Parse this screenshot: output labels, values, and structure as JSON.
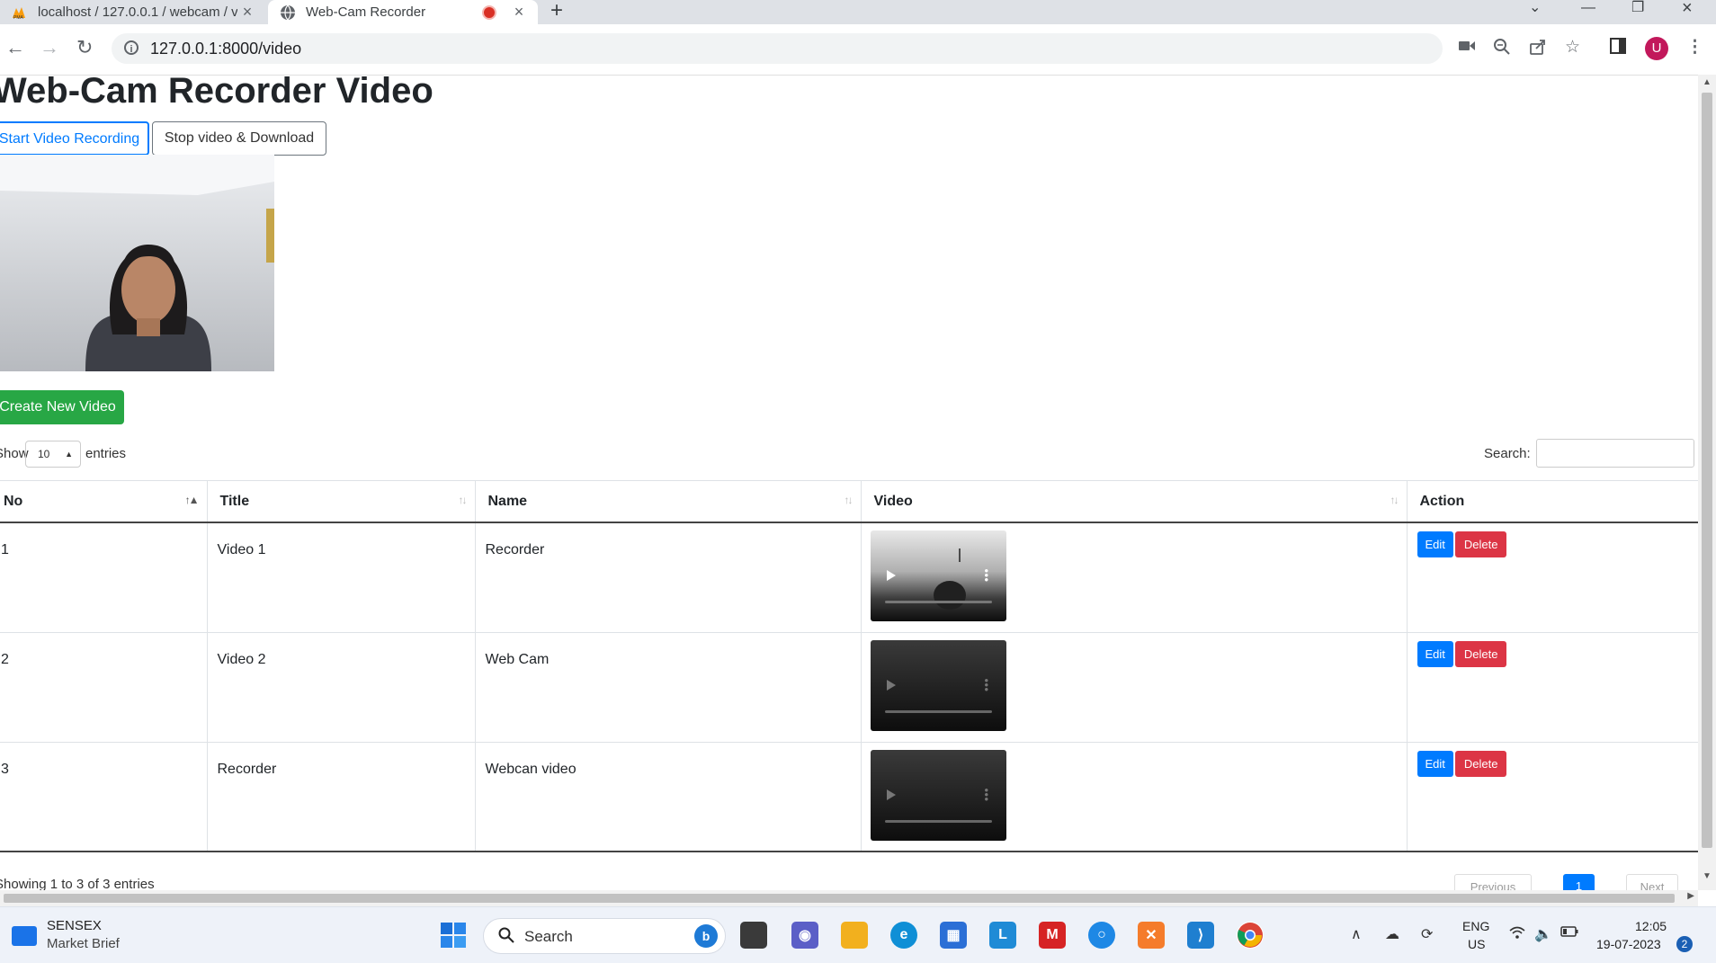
{
  "browser": {
    "tabs": [
      {
        "title": "localhost / 127.0.0.1 / webcam / v"
      },
      {
        "title": "Web-Cam Recorder"
      }
    ],
    "url": "127.0.0.1:8000/video",
    "profile_initial": "U"
  },
  "page": {
    "heading": "Web-Cam Recorder Video",
    "start_label": "Start Video Recording",
    "stop_label": "Stop video & Download",
    "create_label": "Create New Video",
    "length": {
      "show": "Show",
      "value": "10",
      "entries": "entries"
    },
    "search_label": "Search:",
    "table": {
      "headers": [
        "No",
        "Title",
        "Name",
        "Video",
        "Action"
      ],
      "rows": [
        {
          "no": "1",
          "title": "Video 1",
          "name": "Recorder",
          "edit": "Edit",
          "delete": "Delete"
        },
        {
          "no": "2",
          "title": "Video 2",
          "name": "Web Cam",
          "edit": "Edit",
          "delete": "Delete"
        },
        {
          "no": "3",
          "title": "Recorder",
          "name": "Webcan video",
          "edit": "Edit",
          "delete": "Delete"
        }
      ]
    },
    "info": "Showing 1 to 3 of 3 entries",
    "pagination": {
      "previous": "Previous",
      "current": "1",
      "next": "Next"
    }
  },
  "colors": {
    "primary": "#007bff",
    "success": "#28a745",
    "danger": "#dc3545"
  },
  "taskbar": {
    "widget_title": "SENSEX",
    "widget_subtitle": "Market Brief",
    "search_placeholder": "Search",
    "lang": "ENG",
    "region": "US",
    "time": "12:05",
    "date": "19-07-2023",
    "notification_count": "2"
  }
}
